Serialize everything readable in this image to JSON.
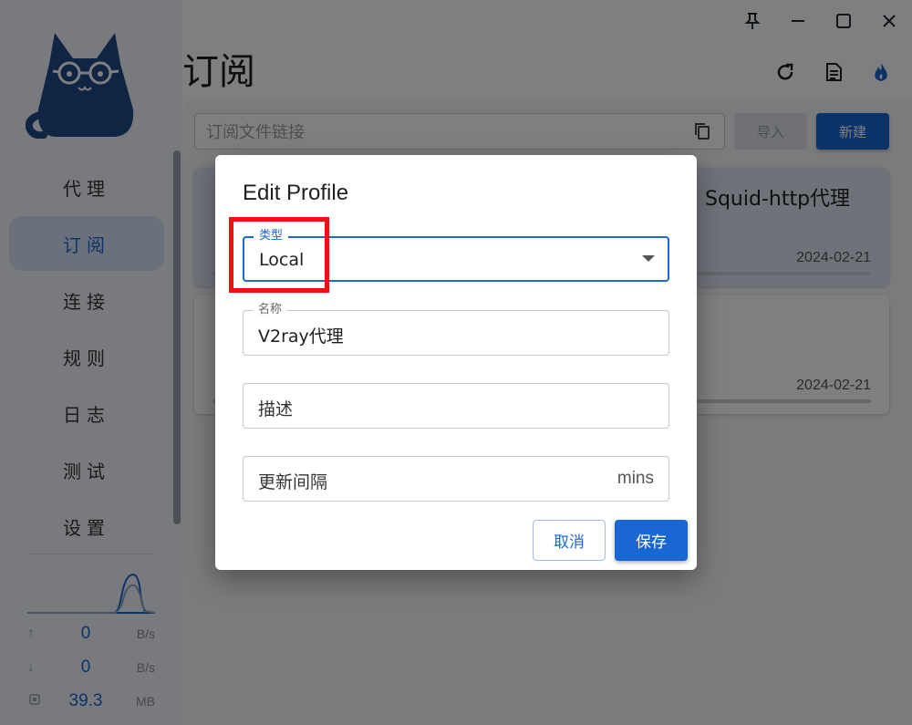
{
  "app": {
    "page_title": "订阅",
    "window_controls": {
      "pin_icon": "pin-icon",
      "minimize_icon": "minimize-icon",
      "maximize_icon": "maximize-icon",
      "close_icon": "close-icon"
    },
    "header_icons": [
      "refresh-icon",
      "log-icon",
      "flame-icon"
    ]
  },
  "sidebar": {
    "logo": "cat-logo",
    "items": [
      {
        "label": "代理"
      },
      {
        "label": "订阅",
        "active": true
      },
      {
        "label": "连接"
      },
      {
        "label": "规则"
      },
      {
        "label": "日志"
      },
      {
        "label": "测试"
      },
      {
        "label": "设置"
      }
    ],
    "stats": {
      "upload": {
        "icon": "arrow-up-icon",
        "value": "0",
        "unit": "B/s"
      },
      "download": {
        "icon": "arrow-down-icon",
        "value": "0",
        "unit": "B/s"
      },
      "memory": {
        "icon": "memory-chip-icon",
        "value": "39.3",
        "unit": "MB"
      }
    }
  },
  "toolbar": {
    "url_placeholder": "订阅文件链接",
    "import_label": "导入",
    "new_label": "新建"
  },
  "profiles": [
    {
      "title": "Squid-http代理",
      "date": "2024-02-21",
      "selected": true
    },
    {
      "title": "",
      "date": "2024-02-21",
      "selected": false
    }
  ],
  "dialog": {
    "title": "Edit Profile",
    "type_field": {
      "label": "类型",
      "value": "Local"
    },
    "name_field": {
      "label": "名称",
      "value": "V2ray代理"
    },
    "desc_field": {
      "placeholder": "描述"
    },
    "interval_field": {
      "placeholder": "更新间隔",
      "suffix": "mins"
    },
    "cancel_label": "取消",
    "save_label": "保存"
  },
  "colors": {
    "accent": "#1967d2",
    "highlight": "#ee1111",
    "sidebar_bg": "#f0f4fa",
    "logo_blue": "#1e4a86"
  }
}
